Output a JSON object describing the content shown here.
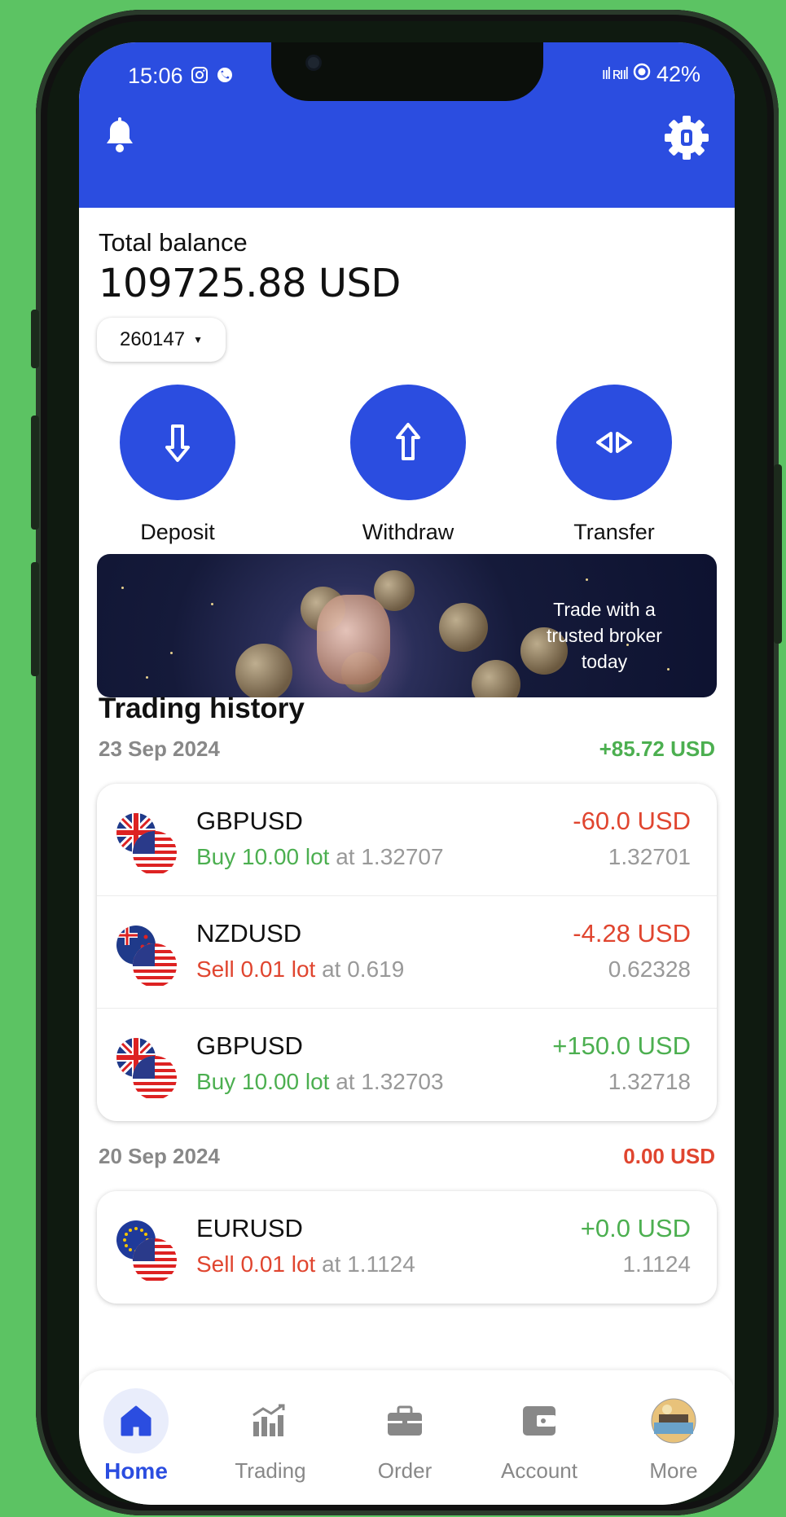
{
  "status_bar": {
    "time": "15:06",
    "signal": "ııl ʀııl",
    "battery": "42%"
  },
  "balance": {
    "label": "Total balance",
    "value": "109725.88 USD",
    "account": "260147"
  },
  "actions": [
    {
      "label": "Deposit"
    },
    {
      "label": "Withdraw"
    },
    {
      "label": "Transfer"
    }
  ],
  "banner": {
    "text": "Trade with a trusted broker today"
  },
  "history": {
    "title": "Trading history",
    "groups": [
      {
        "date": "23 Sep 2024",
        "total": "+85.72 USD",
        "trades": [
          {
            "symbol": "GBPUSD",
            "side": "Buy 10.00 lot",
            "at": " at 1.32707",
            "pnl": "-60.0 USD",
            "price": "1.32701"
          },
          {
            "symbol": "NZDUSD",
            "side": "Sell 0.01 lot",
            "at": " at 0.619",
            "pnl": "-4.28 USD",
            "price": "0.62328"
          },
          {
            "symbol": "GBPUSD",
            "side": "Buy 10.00 lot",
            "at": " at 1.32703",
            "pnl": "+150.0 USD",
            "price": "1.32718"
          }
        ]
      },
      {
        "date": "20 Sep 2024",
        "total": "0.00 USD",
        "trades": [
          {
            "symbol": "EURUSD",
            "side": "Sell 0.01 lot",
            "at": " at 1.1124",
            "pnl": "+0.0 USD",
            "price": "1.1124"
          }
        ]
      }
    ]
  },
  "nav": [
    {
      "label": "Home"
    },
    {
      "label": "Trading"
    },
    {
      "label": "Order"
    },
    {
      "label": "Account"
    },
    {
      "label": "More"
    }
  ],
  "colors": {
    "primary": "#2b4de0",
    "positive": "#4caf50",
    "negative": "#e0452f",
    "background": "#5cc363"
  }
}
